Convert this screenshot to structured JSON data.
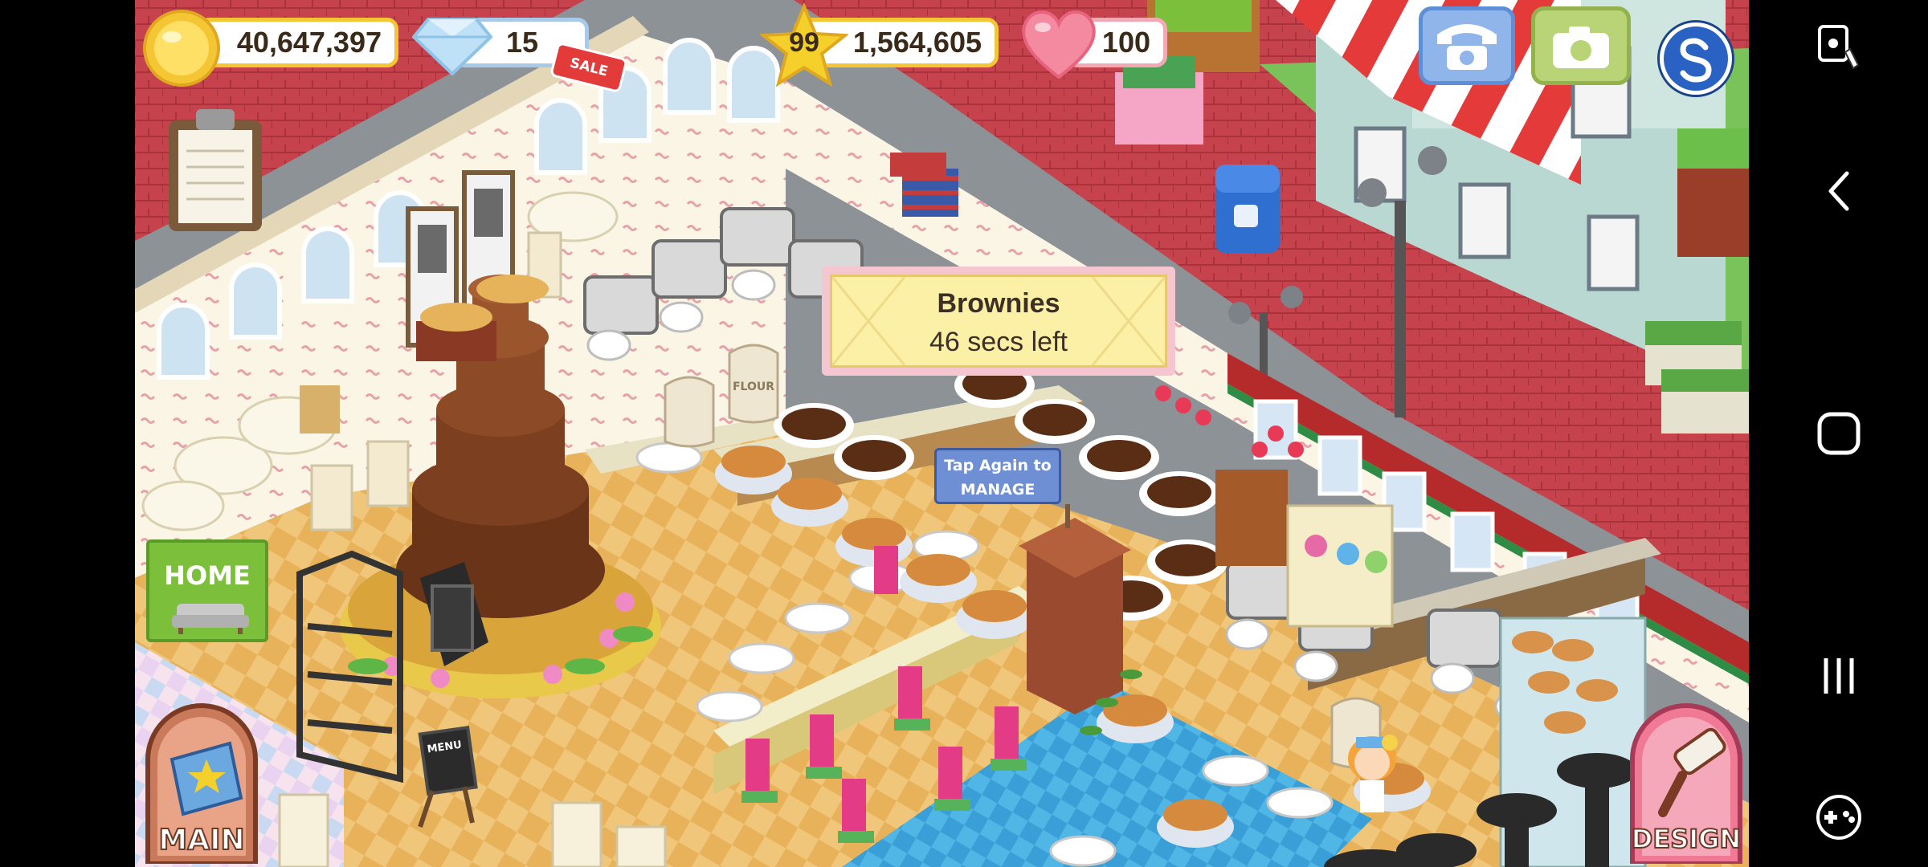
{
  "hud": {
    "coins": "40,647,397",
    "gems": "15",
    "sale_badge": "SALE",
    "level": "99",
    "exp": "1,564,605",
    "hearts": "100"
  },
  "tooltip": {
    "item": "Brownies",
    "time_left": "46 secs left"
  },
  "tap_sign": {
    "line1": "Tap Again to",
    "line2": "MANAGE"
  },
  "buttons": {
    "home_label": "HOME",
    "main_label": "MAIN",
    "design_label": "DESIGN"
  },
  "signs": {
    "flour": "FLOUR",
    "menu": "MENU"
  },
  "colors": {
    "coin_gold": "#f5c634",
    "heart_pink": "#f06e86",
    "home_green": "#7bbf3a",
    "tooltip_yellow": "#fbf0a6"
  }
}
